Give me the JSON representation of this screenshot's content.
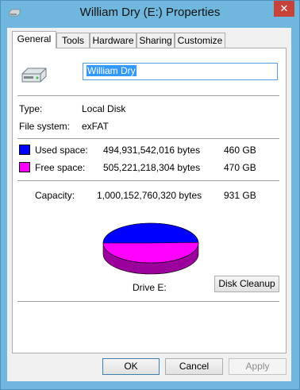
{
  "window": {
    "title": "William Dry (E:) Properties",
    "close_glyph": "✕"
  },
  "tabs": [
    {
      "label": "General",
      "active": true
    },
    {
      "label": "Tools"
    },
    {
      "label": "Hardware"
    },
    {
      "label": "Sharing"
    },
    {
      "label": "Customize"
    }
  ],
  "general": {
    "name_value": "William Dry",
    "type_label": "Type:",
    "type_value": "Local Disk",
    "fs_label": "File system:",
    "fs_value": "exFAT",
    "used": {
      "label": "Used space:",
      "bytes": "494,931,542,016 bytes",
      "size": "460 GB",
      "color": "#0000ff"
    },
    "free": {
      "label": "Free space:",
      "bytes": "505,221,218,304 bytes",
      "size": "470 GB",
      "color": "#ff00ff"
    },
    "capacity": {
      "label": "Capacity:",
      "bytes": "1,000,152,760,320 bytes",
      "size": "931 GB"
    },
    "drive_label": "Drive E:",
    "cleanup_button": "Disk Cleanup",
    "used_fraction": 0.495
  },
  "footer": {
    "ok": "OK",
    "cancel": "Cancel",
    "apply": "Apply"
  }
}
